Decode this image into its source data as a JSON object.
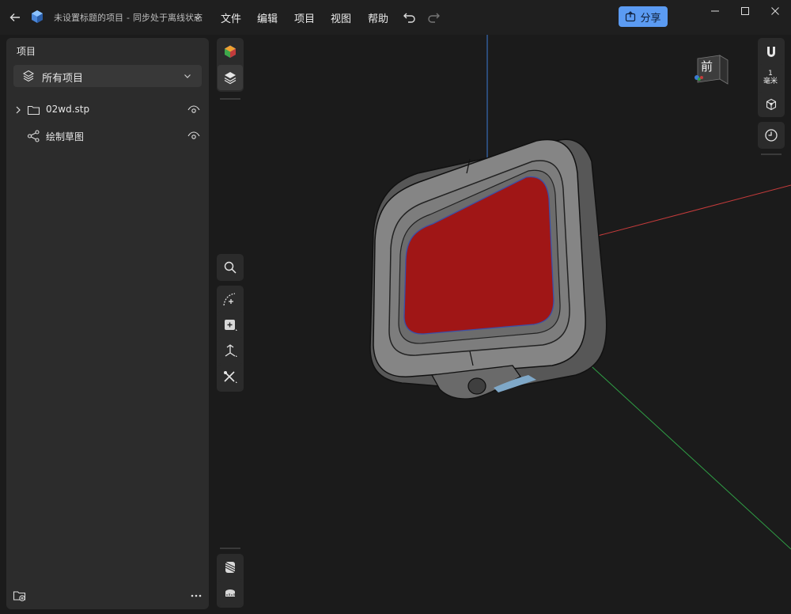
{
  "titlebar": {
    "project_name": "未设置标题的项目",
    "separator": "-",
    "sync_status": "同步处于离线状态",
    "menus": [
      "文件",
      "编辑",
      "项目",
      "视图",
      "帮助"
    ],
    "share_label": "分享",
    "accent": "#5b9bf2"
  },
  "panel": {
    "title": "项目",
    "filter_label": "所有项目",
    "items": [
      {
        "label": "02wd.stp",
        "icon": "folder-icon",
        "expandable": true
      },
      {
        "label": "绘制草图",
        "icon": "sketch-icon",
        "expandable": false
      }
    ]
  },
  "right_strip": {
    "unit_value": "1",
    "unit_label": "毫米"
  },
  "navcube": {
    "face_label": "前"
  },
  "colors": {
    "model_face": "#a01616",
    "model_body": "#7a7a7a",
    "axis_x": "#c43b3b",
    "axis_y": "#2f9e45",
    "axis_z": "#3b7bd4",
    "background": "#1b1b1b"
  }
}
